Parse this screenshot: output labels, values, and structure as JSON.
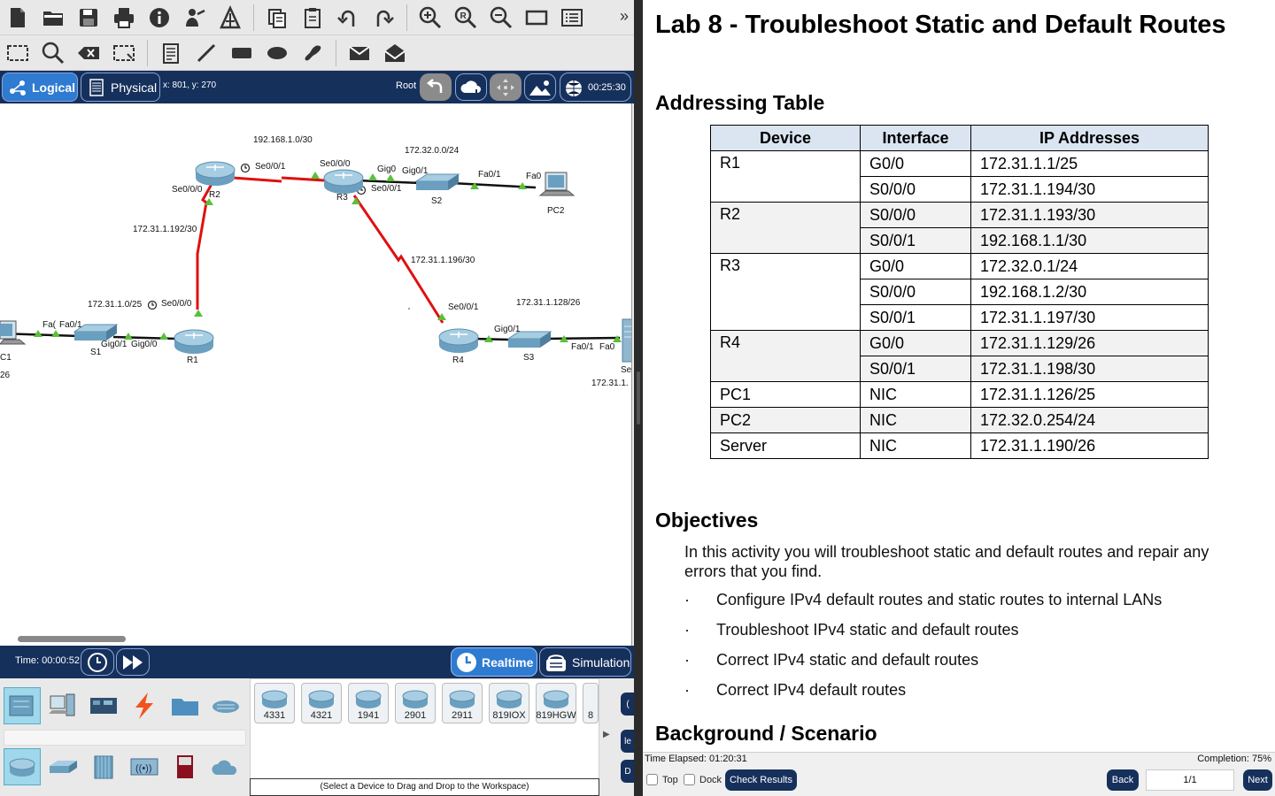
{
  "toolbar": {
    "row1_icons": [
      "new-file-icon",
      "open-folder-icon",
      "save-icon",
      "print-icon",
      "info-icon",
      "activity-wizard-icon",
      "custom-device-icon",
      "copy-icon",
      "paste-icon",
      "undo-icon",
      "redo-icon",
      "zoom-in-icon",
      "zoom-reset-icon",
      "zoom-out-icon",
      "drawing-palette-icon",
      "custom-devices-dialog-icon"
    ],
    "row2_icons": [
      "select-icon",
      "inspect-icon",
      "delete-icon",
      "resize-icon",
      "note-icon",
      "line-icon",
      "rectangle-icon",
      "ellipse-icon",
      "freeform-icon",
      "simple-pdu-icon",
      "complex-pdu-icon"
    ],
    "more_label": "»"
  },
  "navbar": {
    "logical_label": "Logical",
    "physical_label": "Physical",
    "coords": "x: 801, y: 270",
    "root_label": "Root",
    "clock": "00:25:30"
  },
  "topology": {
    "labels": [
      "192.168.1.0/30",
      "172.32.0.0/24",
      "Se0/0/1",
      "Se0/0/0",
      "Gig0",
      "Gig0/1",
      "Fa0/1",
      "Fa0",
      "Se0/0/0",
      "R2",
      "R3",
      "Se0/0/1",
      "S2",
      "PC2",
      "172.31.1.192/30",
      "172.31.1.196/30",
      "172.31.1.0/25",
      "Se0/0/0",
      "172.31.1.128/26",
      "Se0/0/1",
      "Fa(",
      "Fa0/1",
      "S1",
      "Gig0/1",
      "Gig0/0",
      "R1",
      "Gig0/1",
      "R4",
      "S3",
      "Fa0/1",
      "Fa0",
      "Se",
      "172.31.1.",
      "C1",
      "26"
    ]
  },
  "timebar": {
    "time": "Time: 00:00:52",
    "realtime_label": "Realtime",
    "simulation_label": "Simulation"
  },
  "device_panel": {
    "models": [
      "4331",
      "4321",
      "1941",
      "2901",
      "2911",
      "819IOX",
      "819HGW",
      "8"
    ],
    "hint": "(Select a Device to Drag and Drop to the Workspace)"
  },
  "instructions": {
    "title": "Lab 8 - Troubleshoot Static and Default Routes",
    "addressing_heading": "Addressing Table",
    "table_headers": [
      "Device",
      "Interface",
      "IP Addresses"
    ],
    "table_rows": [
      {
        "device": "R1",
        "interfaces": [
          [
            "G0/0",
            "172.31.1.1/25"
          ],
          [
            "S0/0/0",
            "172.31.1.194/30"
          ]
        ]
      },
      {
        "device": "R2",
        "interfaces": [
          [
            "S0/0/0",
            "172.31.1.193/30"
          ],
          [
            "S0/0/1",
            "192.168.1.1/30"
          ]
        ]
      },
      {
        "device": "R3",
        "interfaces": [
          [
            "G0/0",
            "172.32.0.1/24"
          ],
          [
            "S0/0/0",
            "192.168.1.2/30"
          ],
          [
            "S0/0/1",
            "172.31.1.197/30"
          ]
        ]
      },
      {
        "device": "R4",
        "interfaces": [
          [
            "G0/0",
            "172.31.1.129/26"
          ],
          [
            "S0/0/1",
            "172.31.1.198/30"
          ]
        ]
      },
      {
        "device": "PC1",
        "interfaces": [
          [
            "NIC",
            "172.31.1.126/25"
          ]
        ]
      },
      {
        "device": "PC2",
        "interfaces": [
          [
            "NIC",
            "172.32.0.254/24"
          ]
        ]
      },
      {
        "device": "Server",
        "interfaces": [
          [
            "NIC",
            "172.31.1.190/26"
          ]
        ]
      }
    ],
    "objectives_heading": "Objectives",
    "objectives_intro": "In this activity you will troubleshoot static and default routes and repair any errors that you find.",
    "objectives": [
      "Configure IPv4 default routes and static routes to internal LANs",
      "Troubleshoot IPv4 static and default routes",
      "Correct IPv4 static and default routes",
      "Correct IPv4 default routes"
    ],
    "bullet_char": "·",
    "background_heading": "Background / Scenario"
  },
  "footer": {
    "elapsed": "Time Elapsed: 01:20:31",
    "completion": "Completion: 75%",
    "top_label": "Top",
    "dock_label": "Dock",
    "check_results": "Check Results",
    "back": "Back",
    "page": "1/1",
    "next": "Next"
  },
  "colors": {
    "navy": "#16305c",
    "accent_blue": "#2e7bd1",
    "link_red": "#e01010",
    "link_up_green": "#5bbf3a",
    "table_header_bg": "#dbe5f1"
  }
}
